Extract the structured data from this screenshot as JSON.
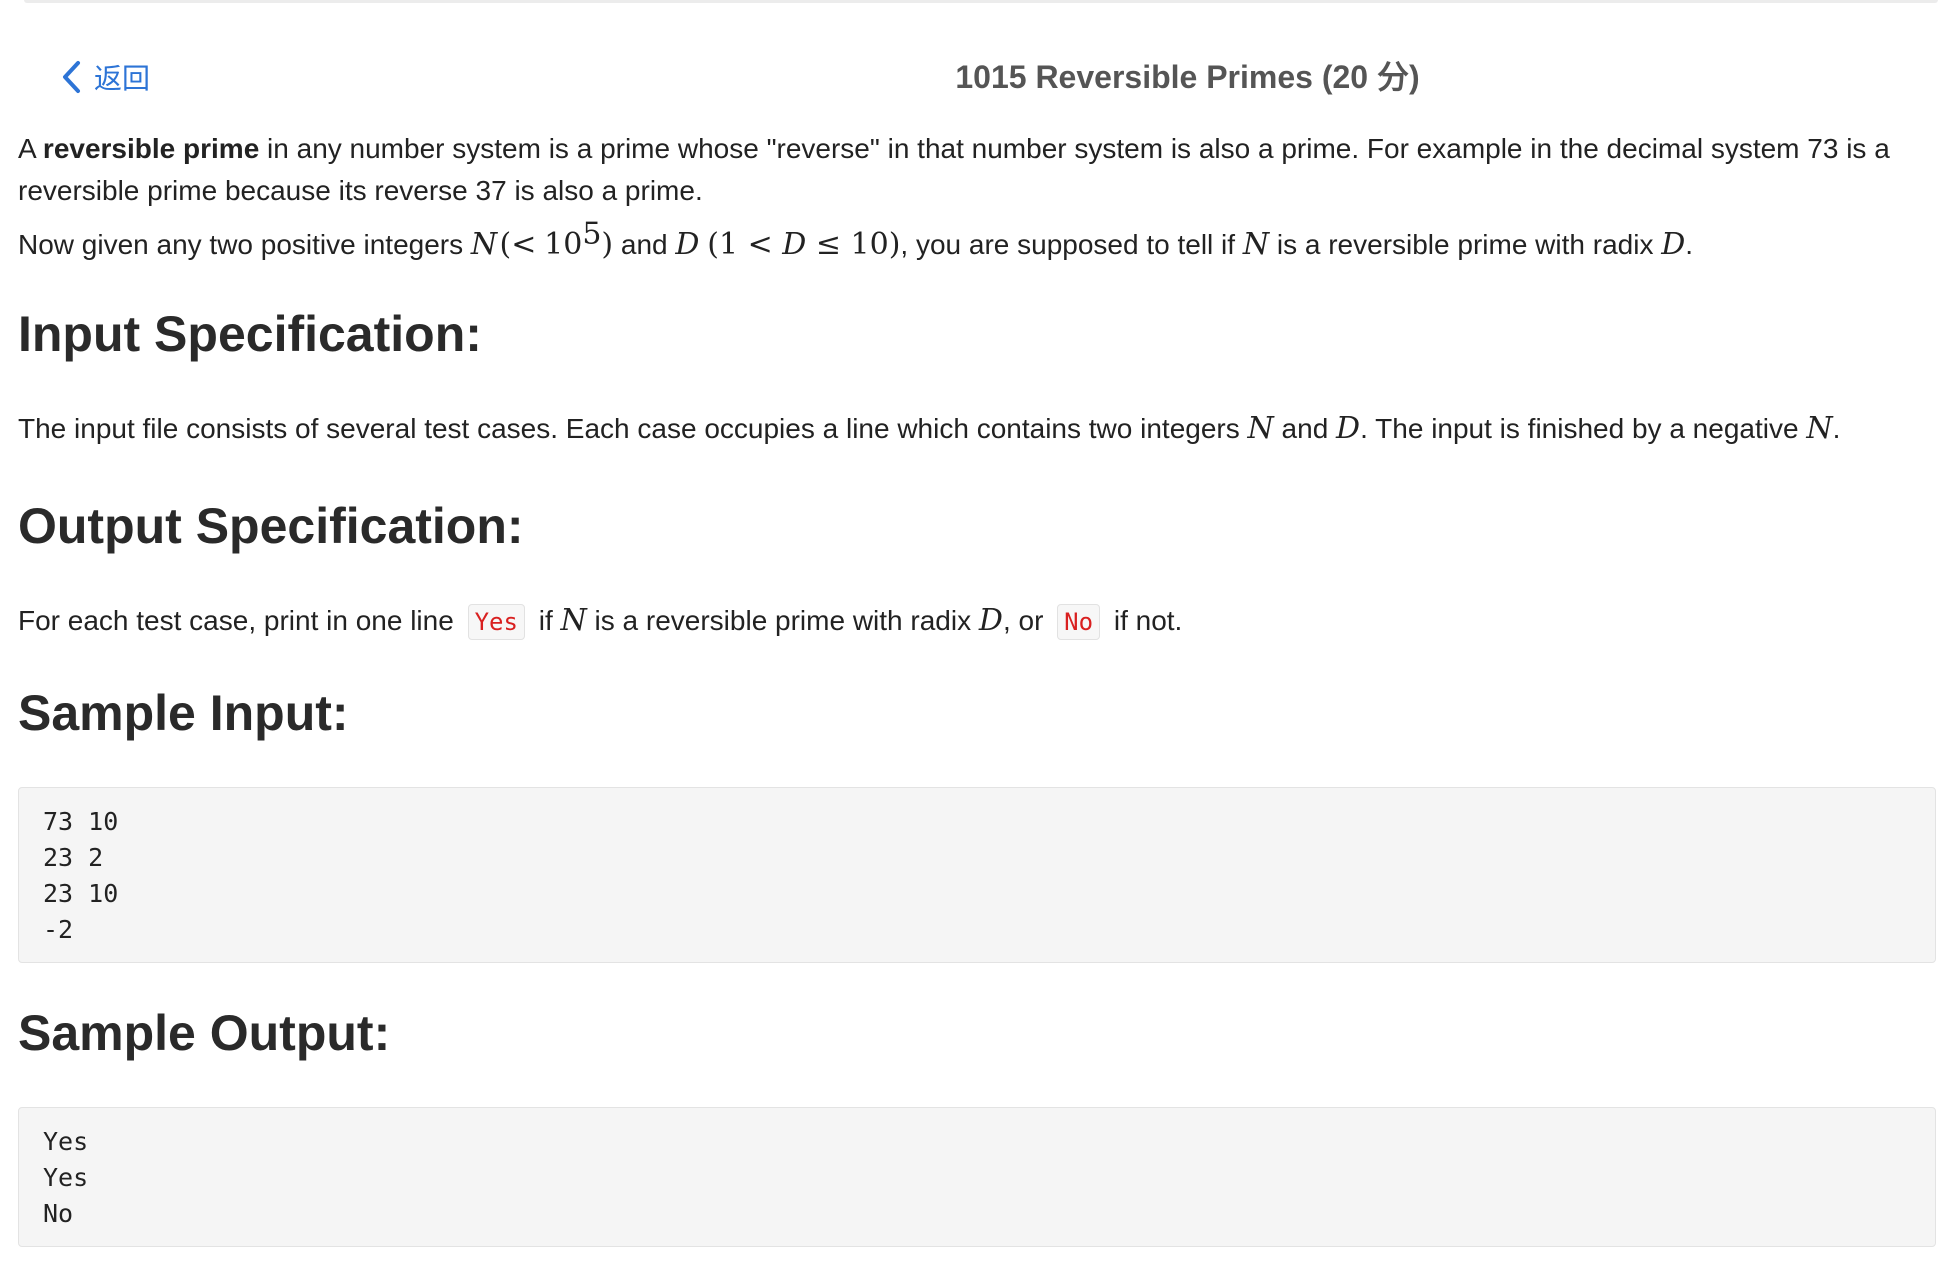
{
  "header": {
    "back_label": "返回",
    "title": "1015 Reversible Primes (20 分)"
  },
  "problem": {
    "intro": {
      "t1": "A ",
      "bold": "reversible prime",
      "t2": " in any number system is a prime whose \"reverse\" in that number system is also a prime. For example in the decimal system 73 is a reversible prime because its reverse 37 is also a prime."
    },
    "task": {
      "t1": "Now given any two positive integers ",
      "m1": "N",
      "m2": "(<",
      "m3": "10",
      "m3_sup": "5",
      "m4": ")",
      "t2": " and ",
      "m5": "D",
      "m6": "(1 < ",
      "m7": "D",
      "m8": " ≤ 10)",
      "t3": ", you are supposed to tell if ",
      "m9": "N",
      "t4": " is a reversible prime with radix ",
      "m10": "D",
      "t5": "."
    }
  },
  "input_spec": {
    "heading": "Input Specification:",
    "t1": "The input file consists of several test cases. Each case occupies a line which contains two integers ",
    "m1": "N",
    "t2": " and ",
    "m2": "D",
    "t3": ". The input is finished by a negative ",
    "m3": "N",
    "t4": "."
  },
  "output_spec": {
    "heading": "Output Specification:",
    "t1": "For each test case, print in one line ",
    "code_yes": "Yes",
    "t2": " if ",
    "m1": "N",
    "t3": " is a reversible prime with radix ",
    "m2": "D",
    "t4": ", or ",
    "code_no": "No",
    "t5": " if not."
  },
  "sample_input": {
    "heading": "Sample Input:",
    "lines": [
      "73 10",
      "23 2",
      "23 10",
      "-2"
    ]
  },
  "sample_output": {
    "heading": "Sample Output:",
    "lines": [
      "Yes",
      "Yes",
      "No"
    ]
  },
  "colors": {
    "link": "#2d74d6",
    "code_text": "#d92020",
    "code_bg": "#f5f5f5"
  }
}
